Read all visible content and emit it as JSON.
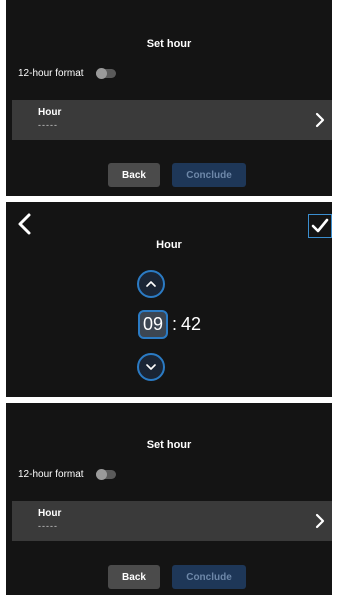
{
  "screen1": {
    "title": "Set hour",
    "format_label": "12-hour format",
    "format_enabled": false,
    "hour_label": "Hour",
    "hour_value": "-----",
    "back_label": "Back",
    "conclude_label": "Conclude"
  },
  "screen2": {
    "title": "Hour",
    "hours": "09",
    "separator": ":",
    "minutes": "42",
    "icons": [
      "chevron-left-icon",
      "checkmark-icon",
      "chevron-up-icon",
      "chevron-down-icon"
    ]
  },
  "screen3": {
    "title": "Set hour",
    "format_label": "12-hour format",
    "format_enabled": false,
    "hour_label": "Hour",
    "hour_value": "-----",
    "back_label": "Back",
    "conclude_label": "Conclude"
  },
  "colors": {
    "panel_bg": "#141414",
    "row_bg": "#3a3a3a",
    "accent": "#2b7bc4",
    "conclude_bg": "#1e3758",
    "back_bg": "#4b4b4b"
  }
}
